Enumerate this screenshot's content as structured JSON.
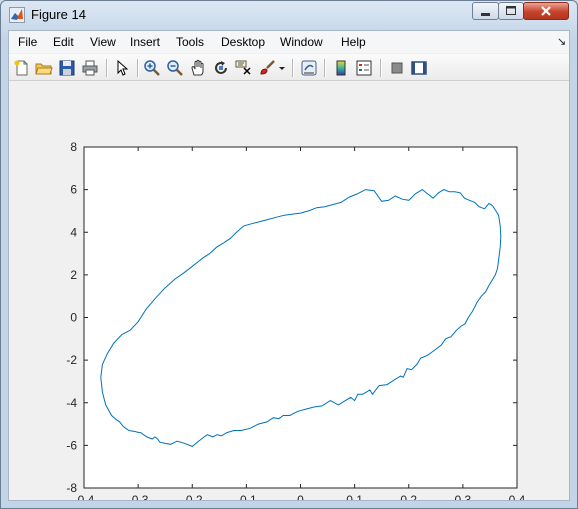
{
  "window": {
    "title": "Figure 14"
  },
  "menu": [
    "File",
    "Edit",
    "View",
    "Insert",
    "Tools",
    "Desktop",
    "Window",
    "Help"
  ],
  "toolbar": [
    "new-figure-icon",
    "open-file-icon",
    "save-icon",
    "print-icon",
    "select-arrow-icon",
    "zoom-in-icon",
    "zoom-out-icon",
    "pan-hand-icon",
    "rotate-3d-icon",
    "data-cursor-icon",
    "brush-icon",
    "brush-dropdown-icon",
    "link-plot-icon",
    "insert-colorbar-icon",
    "insert-legend-icon",
    "hide-plot-tools-icon",
    "show-plot-tools-icon"
  ],
  "colors": {
    "line": "#0072bd",
    "close_button": "#c7432a",
    "figure_bg": "#f0f0f0"
  },
  "chart_data": {
    "type": "line",
    "title": "",
    "xlabel": "",
    "ylabel": "",
    "xlim": [
      -0.4,
      0.4
    ],
    "ylim": [
      -8,
      8
    ],
    "xticks": [
      "-0.4",
      "-0.3",
      "-0.2",
      "-0.1",
      "0",
      "0.1",
      "0.2",
      "0.3",
      "0.4"
    ],
    "yticks": [
      "-8",
      "-6",
      "-4",
      "-2",
      "0",
      "2",
      "4",
      "6",
      "8"
    ],
    "grid": false,
    "series": [
      {
        "color": "#0072bd",
        "x": [
          -0.369,
          -0.366,
          -0.36,
          -0.349,
          -0.34,
          -0.334,
          -0.328,
          -0.323,
          -0.317,
          -0.306,
          -0.298,
          -0.295,
          -0.29,
          -0.284,
          -0.274,
          -0.269,
          -0.264,
          -0.26,
          -0.251,
          -0.24,
          -0.228,
          -0.215,
          -0.2,
          -0.188,
          -0.178,
          -0.172,
          -0.162,
          -0.154,
          -0.146,
          -0.136,
          -0.123,
          -0.11,
          -0.093,
          -0.078,
          -0.062,
          -0.05,
          -0.04,
          -0.032,
          -0.02,
          -0.005,
          0.01,
          0.025,
          0.04,
          0.055,
          0.07,
          0.083,
          0.093,
          0.1,
          0.106,
          0.115,
          0.122,
          0.128,
          0.133,
          0.145,
          0.16,
          0.175,
          0.185,
          0.19,
          0.197,
          0.205,
          0.215,
          0.222,
          0.228,
          0.236,
          0.244,
          0.252,
          0.26,
          0.268,
          0.278,
          0.288,
          0.297,
          0.304,
          0.31,
          0.318,
          0.326,
          0.334,
          0.342,
          0.348,
          0.354,
          0.36,
          0.364,
          0.366,
          0.369,
          0.37,
          0.369,
          0.366,
          0.361,
          0.356,
          0.352,
          0.348,
          0.34,
          0.33,
          0.322,
          0.312,
          0.303,
          0.295,
          0.285,
          0.275,
          0.265,
          0.255,
          0.245,
          0.235,
          0.225,
          0.212,
          0.2,
          0.188,
          0.175,
          0.163,
          0.15,
          0.136,
          0.12,
          0.105,
          0.09,
          0.075,
          0.06,
          0.045,
          0.03,
          0.015,
          0.0,
          -0.015,
          -0.03,
          -0.045,
          -0.06,
          -0.075,
          -0.09,
          -0.105,
          -0.118,
          -0.13,
          -0.142,
          -0.155,
          -0.168,
          -0.18,
          -0.19,
          -0.2,
          -0.215,
          -0.232,
          -0.25,
          -0.268,
          -0.285,
          -0.3,
          -0.315,
          -0.33,
          -0.345,
          -0.357,
          -0.366,
          -0.369
        ],
        "y": [
          -2.8,
          -3.5,
          -4.1,
          -4.6,
          -4.8,
          -4.9,
          -5.1,
          -5.2,
          -5.3,
          -5.35,
          -5.4,
          -5.4,
          -5.5,
          -5.6,
          -5.7,
          -5.6,
          -5.7,
          -5.85,
          -5.9,
          -5.95,
          -5.8,
          -5.9,
          -6.05,
          -5.8,
          -5.6,
          -5.5,
          -5.6,
          -5.5,
          -5.55,
          -5.4,
          -5.3,
          -5.3,
          -5.2,
          -5.0,
          -4.9,
          -4.7,
          -4.75,
          -4.6,
          -4.6,
          -4.4,
          -4.3,
          -4.2,
          -4.15,
          -3.9,
          -4.1,
          -3.9,
          -3.75,
          -3.9,
          -3.6,
          -3.6,
          -3.5,
          -3.4,
          -3.6,
          -3.2,
          -3.15,
          -2.9,
          -2.75,
          -2.8,
          -2.4,
          -2.45,
          -2.2,
          -1.9,
          -1.85,
          -1.75,
          -1.6,
          -1.45,
          -1.3,
          -1.0,
          -0.9,
          -0.6,
          -0.4,
          -0.3,
          0.0,
          0.3,
          0.7,
          1.0,
          1.2,
          1.5,
          1.75,
          2.0,
          2.3,
          2.7,
          3.3,
          3.8,
          4.3,
          4.8,
          5.0,
          5.2,
          5.3,
          5.35,
          5.1,
          5.2,
          5.4,
          5.5,
          5.6,
          5.85,
          5.9,
          5.9,
          6.0,
          5.85,
          5.6,
          5.8,
          6.0,
          5.8,
          5.5,
          5.55,
          5.7,
          5.5,
          5.45,
          5.95,
          6.0,
          5.8,
          5.65,
          5.4,
          5.3,
          5.2,
          5.15,
          5.0,
          4.9,
          4.85,
          4.8,
          4.7,
          4.6,
          4.5,
          4.4,
          4.3,
          4.0,
          3.7,
          3.5,
          3.3,
          3.0,
          2.8,
          2.6,
          2.4,
          2.1,
          1.8,
          1.4,
          0.9,
          0.4,
          -0.2,
          -0.6,
          -0.8,
          -1.2,
          -1.7,
          -2.2,
          -2.8
        ]
      }
    ]
  }
}
